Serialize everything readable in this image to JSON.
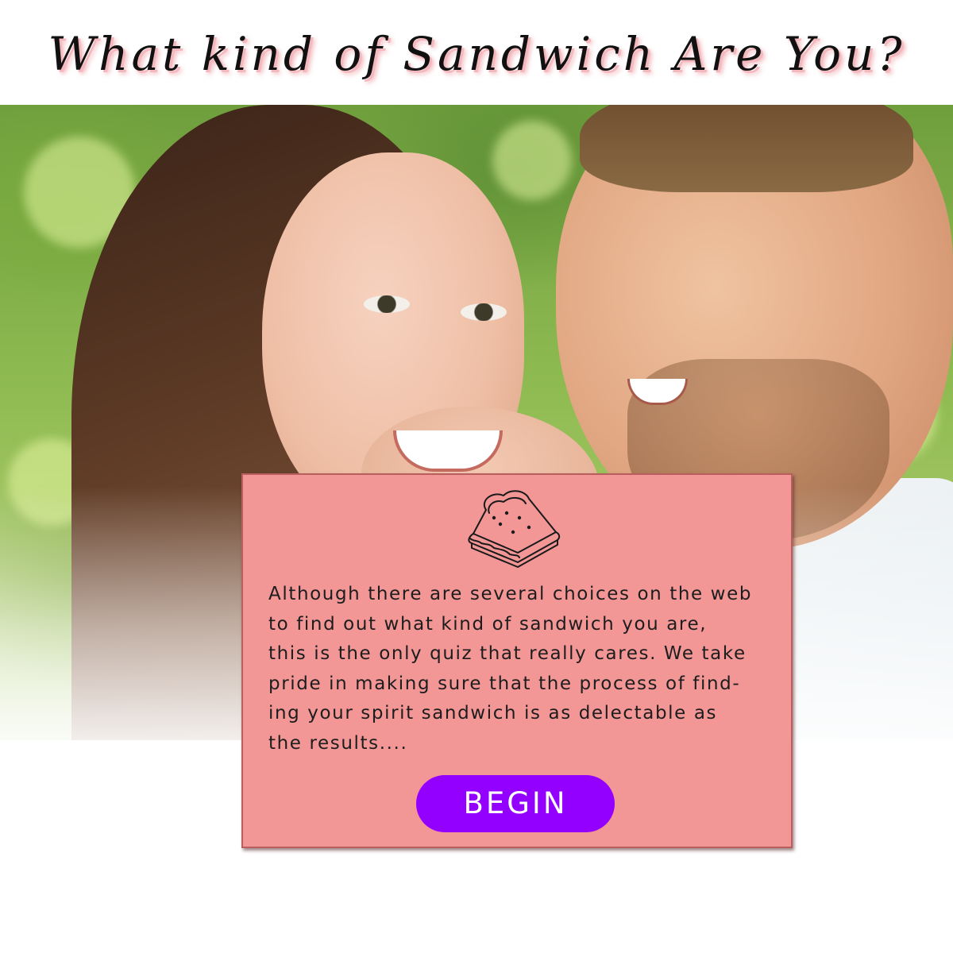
{
  "header": {
    "title": "What kind of Sandwich Are You?"
  },
  "hero": {
    "image": "couple-smiling-photo"
  },
  "card": {
    "icon": "sandwich-icon",
    "description": "Although there are several choices on the web\nto find out what kind of sandwich you are,\nthis is the only quiz that really cares. We take\npride in making sure that the process of find-\ning your spirit sandwich is as delectable as\nthe results....",
    "button_label": "BEGIN"
  },
  "colors": {
    "card_background": "#f29696",
    "button_background": "#9300ff",
    "button_text": "#ffffff",
    "title_shadow": "#f4b9be"
  }
}
